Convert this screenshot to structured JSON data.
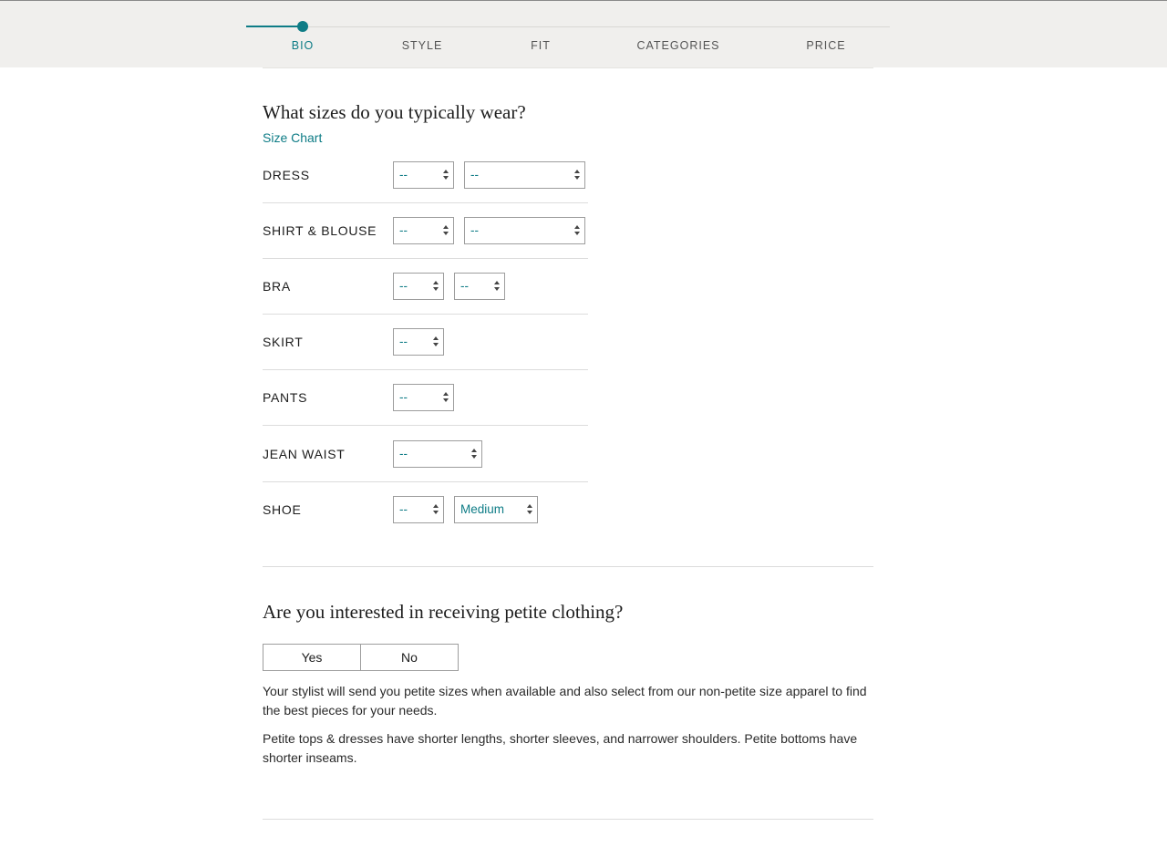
{
  "steps": [
    {
      "label": "BIO",
      "active": true
    },
    {
      "label": "STYLE",
      "active": false
    },
    {
      "label": "FIT",
      "active": false
    },
    {
      "label": "CATEGORIES",
      "active": false
    },
    {
      "label": "PRICE",
      "active": false
    }
  ],
  "progress": {
    "current_step": 1,
    "total_steps": 5
  },
  "sizes": {
    "title": "What sizes do you typically wear?",
    "size_chart_link": "Size Chart",
    "rows": [
      {
        "label": "DRESS",
        "selects": [
          "--",
          "--"
        ]
      },
      {
        "label": "SHIRT & BLOUSE",
        "selects": [
          "--",
          "--"
        ]
      },
      {
        "label": "BRA",
        "selects": [
          "--",
          "--"
        ]
      },
      {
        "label": "SKIRT",
        "selects": [
          "--"
        ]
      },
      {
        "label": "PANTS",
        "selects": [
          "--"
        ]
      },
      {
        "label": "JEAN WAIST",
        "selects": [
          "--"
        ]
      },
      {
        "label": "SHOE",
        "selects": [
          "--",
          "Medium"
        ]
      }
    ]
  },
  "petite": {
    "title": "Are you interested in receiving petite clothing?",
    "options": [
      "Yes",
      "No"
    ],
    "paragraph_1": "Your stylist will send you petite sizes when available and also select from our non-petite size apparel to find the best pieces for your needs.",
    "paragraph_2": "Petite tops & dresses have shorter lengths, shorter sleeves, and narrower shoulders. Petite bottoms have shorter inseams."
  },
  "colors": {
    "accent": "#0e7c86",
    "header_bg": "#f0efed",
    "text": "#1d1d1d",
    "border": "#9d9d9d"
  }
}
